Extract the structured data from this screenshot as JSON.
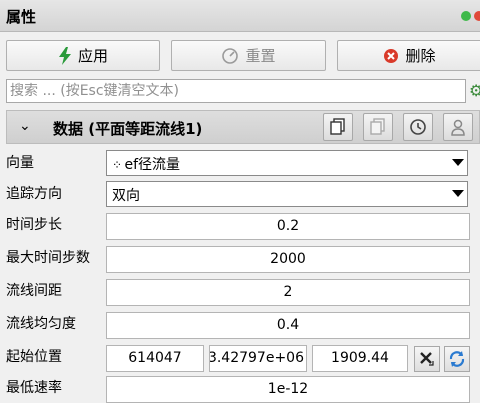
{
  "panel": {
    "title": "属性"
  },
  "toolbar": {
    "apply_label": "应用",
    "reset_label": "重置",
    "delete_label": "删除"
  },
  "search": {
    "placeholder": "搜索 ... (按Esc键清空文本)"
  },
  "section": {
    "title": "数据 (平面等距流线1)"
  },
  "properties": {
    "vector": {
      "label": "向量",
      "value": "ef径流量"
    },
    "direction": {
      "label": "追踪方向",
      "value": "双向"
    },
    "time_step": {
      "label": "时间步长",
      "value": "0.2"
    },
    "max_steps": {
      "label": "最大时间步数",
      "value": "2000"
    },
    "spacing": {
      "label": "流线间距",
      "value": "2"
    },
    "uniformity": {
      "label": "流线均匀度",
      "value": "0.4"
    },
    "start_pos": {
      "label": "起始位置",
      "x": "614047",
      "y": "3.42797e+06",
      "z": "1909.44"
    },
    "min_speed": {
      "label": "最低速率",
      "value": "1e-12"
    }
  },
  "colors": {
    "apply_icon": "#2a9a3a",
    "delete_icon": "#d93a2a",
    "refresh_icon": "#2a7ad0"
  }
}
